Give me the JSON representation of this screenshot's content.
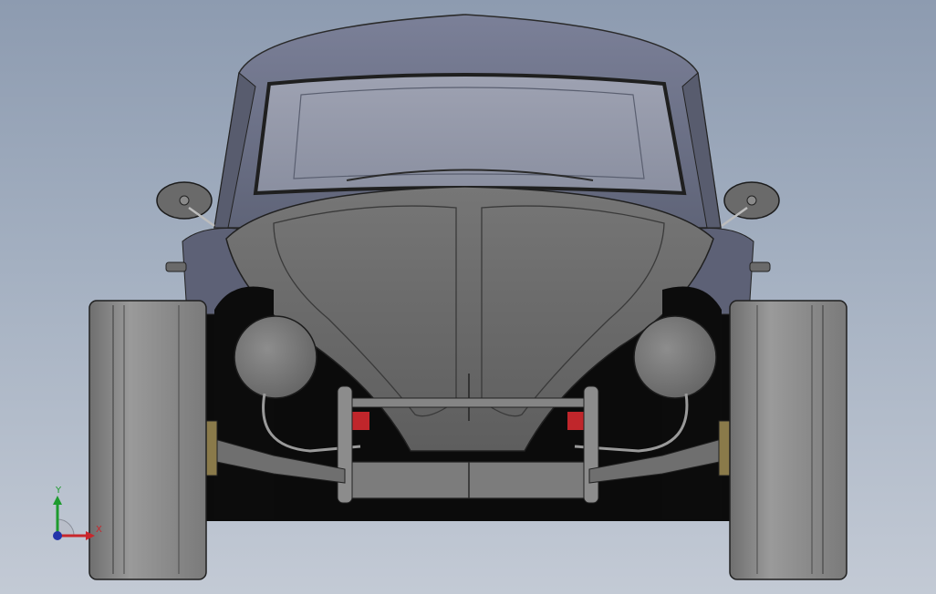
{
  "viewport": {
    "background_top": "#8d9bb0",
    "background_bottom": "#c3cad5"
  },
  "model": {
    "name": "beetle-car-front-view",
    "body_color": "#6d7287",
    "hood_color": "#6b6b6b",
    "tire_color": "#8a8a8a",
    "shadow_color": "#0a0a0a",
    "accent_red": "#c0262b"
  },
  "triad": {
    "y_label": "Y",
    "x_label": "X",
    "y_color": "#1d9b2e",
    "x_color": "#c8262b",
    "z_color": "#2233aa"
  }
}
